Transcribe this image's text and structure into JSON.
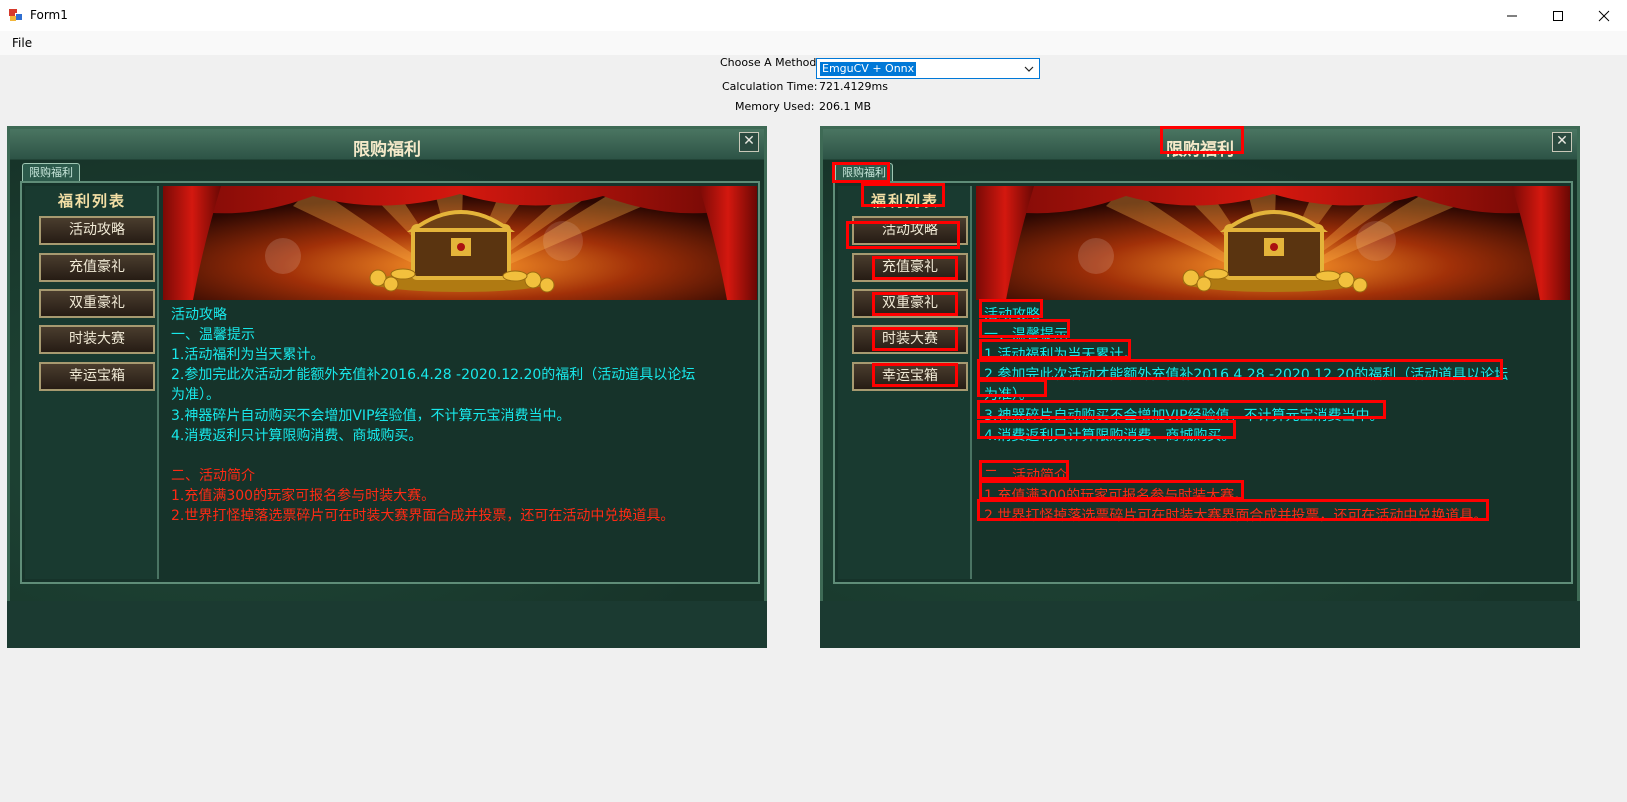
{
  "window": {
    "title": "Form1",
    "buttons": {
      "minimize": "—",
      "maximize": "☐",
      "close": "✕"
    }
  },
  "menu": {
    "file": "File"
  },
  "controls": {
    "method_label": "Choose A Method",
    "method_value": "EmguCV + Onnx",
    "time_label": "Calculation Time:",
    "time_value": "721.4129ms",
    "memory_label": "Memory Used:",
    "memory_value": "206.1 MB"
  },
  "game_window": {
    "title": "限购福利",
    "tab": "限购福利",
    "list_title": "福利列表",
    "nav": [
      "活动攻略",
      "充值豪礼",
      "双重豪礼",
      "时装大赛",
      "幸运宝箱"
    ],
    "lines": [
      {
        "text": "活动攻略",
        "color": "cyan"
      },
      {
        "text": "一、温馨提示",
        "color": "cyan"
      },
      {
        "text": "1.活动福利为当天累计。",
        "color": "cyan"
      },
      {
        "text": "2.参加完此次活动才能额外充值补2016.4.28 -2020.12.20的福利（活动道具以论坛",
        "color": "cyan"
      },
      {
        "text": "为准）。",
        "color": "cyan"
      },
      {
        "text": "3.神器碎片自动购买不会增加VIP经验值，不计算元宝消费当中。",
        "color": "cyan"
      },
      {
        "text": "4.消费返利只计算限购消费、商城购买。",
        "color": "cyan"
      },
      {
        "text": "二、活动简介",
        "color": "red"
      },
      {
        "text": "1.充值满300的玩家可报名参与时装大赛。",
        "color": "red"
      },
      {
        "text": "2.世界打怪掉落选票碎片可在时装大赛界面合成并投票，还可在活动中兑换道具。",
        "color": "red"
      }
    ],
    "colors": {
      "cyan": "#18e8ea",
      "red": "#ff2a14",
      "detection_box": "#ff0000"
    }
  }
}
